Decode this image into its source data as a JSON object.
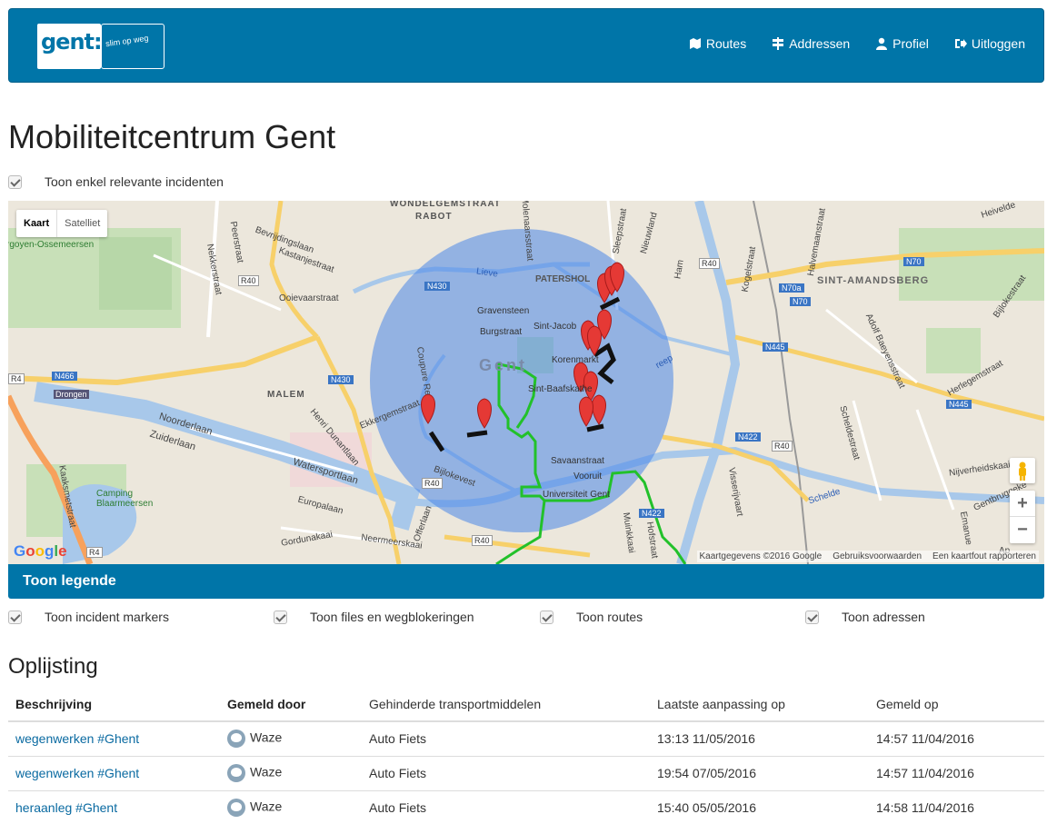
{
  "navbar": {
    "logo_main": "gent:",
    "logo_sub": "slim op weg",
    "links": [
      {
        "label": "Routes",
        "icon": "map-icon"
      },
      {
        "label": "Addressen",
        "icon": "signpost-icon"
      },
      {
        "label": "Profiel",
        "icon": "user-icon"
      },
      {
        "label": "Uitloggen",
        "icon": "logout-icon"
      }
    ]
  },
  "page": {
    "title": "Mobiliteitcentrum Gent",
    "relevant_filter": "Toon enkel relevante incidenten"
  },
  "map": {
    "type_active": "Kaart",
    "type_inactive": "Satelliet",
    "zoom_in": "+",
    "zoom_out": "−",
    "google": "Google",
    "footer": [
      "Kaartgegevens ©2016 Google",
      "Gebruiksvoorwaarden",
      "Een kaartfout rapporteren"
    ],
    "labels": {
      "wondelgem": "WONDELGEMSTRAAT",
      "rabot": "RABOT",
      "patershol": "PATERSHOL",
      "sint_amandsberg": "SINT-AMANDSBERG",
      "malem": "MALEM",
      "gent": "Gent",
      "gravensteen": "Gravensteen",
      "burgstraat": "Burgstraat",
      "sint_jacob": "Sint-Jacob",
      "korenmarkt": "Korenmarkt",
      "sint_baafs": "Sint-Baafskathe",
      "savaanstraat": "Savaanstraat",
      "vooruit": "Vooruit",
      "universiteit": "Universiteit Gent",
      "noorderlaan": "Noorderlaan",
      "zuiderlaan": "Zuiderlaan",
      "watersportlaan": "Watersportlaan",
      "europalaan": "Europalaan",
      "gordunakaai": "Gordunakaai",
      "neermeerskaai": "Neermeerskaai",
      "camping": "Camping Blaarmeersen",
      "drongen": "Drongen",
      "ossemeersen": "rgoyen-Ossemeersen",
      "bevrijdingslaan": "Bevrijdingslaan",
      "kastanjestraat": "Kastanjestraat",
      "ooievaarstraat": "Ooievaarstraat",
      "nekkerstraat": "Nekkerstraat",
      "peerstraat": "Peerstraat",
      "henri_dunant": "Henri Dunantlaan",
      "ekkergem": "Ekkergemstraat",
      "coupure": "Coupure Re",
      "bijlokevest": "Bijlokevest",
      "offerlaan": "Offerlaan",
      "vissersnijverkaai": "Visserijvaart",
      "scheldestraat": "Scheldestraat",
      "adolf": "Adolf Baeyensstraat",
      "herlegem": "Herlegemstraat",
      "nijverheidskaai": "Nijverheidskaai",
      "gentbrugge": "Gentbruggeke",
      "schelde": "Schelde",
      "muinkkaai": "Muinkkaai",
      "hofstraat": "Hofstraat",
      "heivelden": "Heivelde",
      "halvemaan": "Halvemaanstraat",
      "kogelstraat": "Kogelstraat",
      "bijlokestraat": "Bijlokestraat",
      "sleepstraat": "Sleepstraat",
      "nieuwland": "Nieuwland",
      "ham": "Ham",
      "molenaars": "Molenaarsstraat",
      "lieve": "Lieve",
      "reep": "reep",
      "kaakstraat": "Kaaksmetstraat",
      "emanuel": "Emanue",
      "r40": "R40",
      "r4": "R4",
      "n430": "N430",
      "n466": "N466",
      "n70": "N70",
      "n70a": "N70a",
      "n445": "N445",
      "n422": "N422",
      "ap": "Ap"
    }
  },
  "legend": {
    "toggle": "Toon legende",
    "filters": [
      "Toon incident markers",
      "Toon files en wegblokeringen",
      "Toon routes",
      "Toon adressen"
    ]
  },
  "listing": {
    "title": "Oplijsting",
    "columns": [
      "Beschrijving",
      "Gemeld door",
      "Gehinderde transportmiddelen",
      "Laatste aanpassing op",
      "Gemeld op"
    ],
    "rows": [
      {
        "description": "wegenwerken #Ghent",
        "reporter": "Waze",
        "transport": "Auto Fiets",
        "updated": "13:13 11/05/2016",
        "reported": "14:57 11/04/2016"
      },
      {
        "description": "wegenwerken #Ghent",
        "reporter": "Waze",
        "transport": "Auto Fiets",
        "updated": "19:54 07/05/2016",
        "reported": "14:57 11/04/2016"
      },
      {
        "description": "heraanleg #Ghent",
        "reporter": "Waze",
        "transport": "Auto Fiets",
        "updated": "15:40 05/05/2016",
        "reported": "14:58 11/04/2016"
      }
    ]
  }
}
